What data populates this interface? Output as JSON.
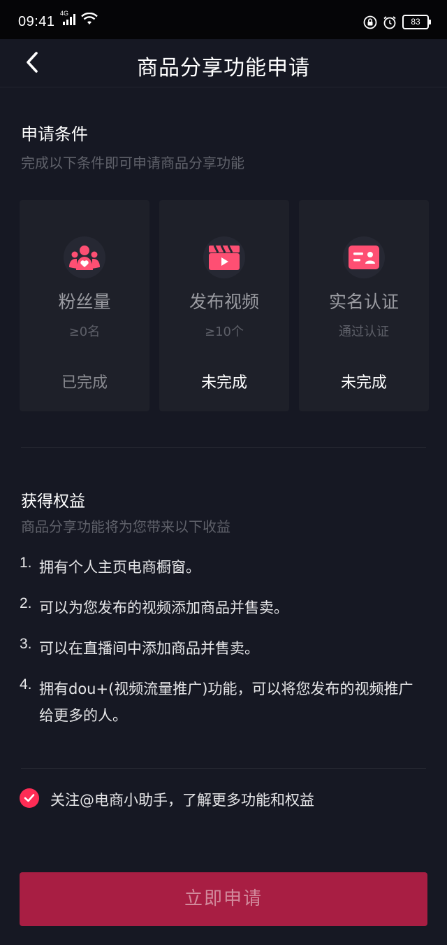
{
  "status_bar": {
    "time": "09:41",
    "network": "4G",
    "battery": "83",
    "icons": [
      "signal-icon",
      "wifi-icon",
      "lock-icon",
      "alarm-icon",
      "battery-icon"
    ]
  },
  "nav": {
    "title": "商品分享功能申请",
    "back_icon": "back-chevron-icon"
  },
  "conditions": {
    "title": "申请条件",
    "subtitle": "完成以下条件即可申请商品分享功能",
    "cards": [
      {
        "icon": "fans-icon",
        "title": "粉丝量",
        "requirement": "≥0名",
        "status": "已完成"
      },
      {
        "icon": "video-clapper-icon",
        "title": "发布视频",
        "requirement": "≥10个",
        "status": "未完成"
      },
      {
        "icon": "id-card-icon",
        "title": "实名认证",
        "requirement": "通过认证",
        "status": "未完成"
      }
    ]
  },
  "benefits": {
    "title": "获得权益",
    "subtitle": "商品分享功能将为您带来以下收益",
    "items": [
      {
        "num": "1.",
        "text": "拥有个人主页电商橱窗。"
      },
      {
        "num": "2.",
        "text": "可以为您发布的视频添加商品并售卖。"
      },
      {
        "num": "3.",
        "text": "可以在直播间中添加商品并售卖。"
      },
      {
        "num": "4.",
        "text": "拥有dou+(视频流量推广)功能，可以将您发布的视频推广给更多的人。"
      }
    ]
  },
  "follow": {
    "checked": true,
    "label": "关注@电商小助手，了解更多功能和权益"
  },
  "apply_button": {
    "label": "立即申请"
  },
  "colors": {
    "background": "#161823",
    "accent": "#fe2c55",
    "button_disabled": "#a81e43"
  }
}
